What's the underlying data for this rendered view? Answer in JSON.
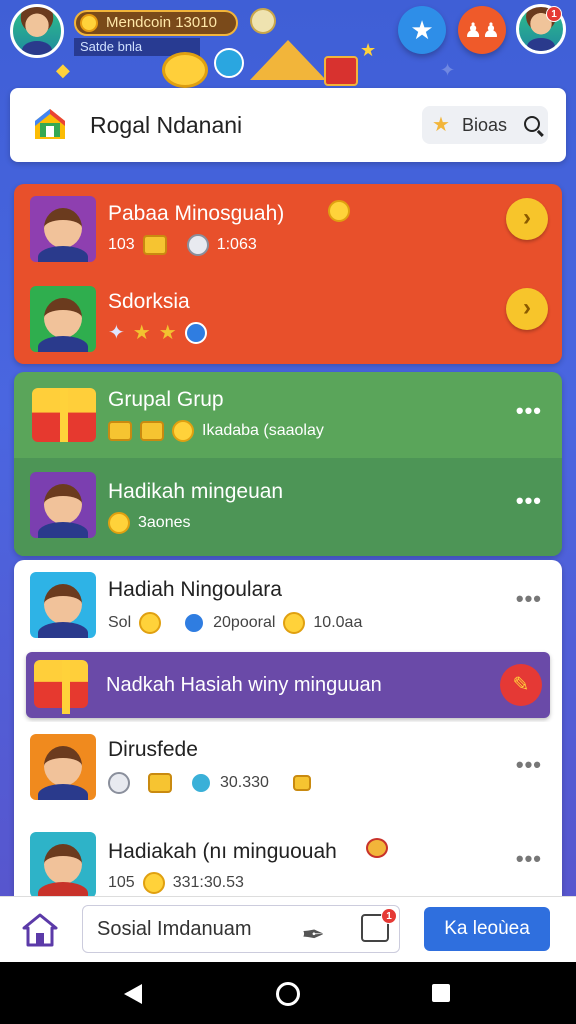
{
  "topbar": {
    "coins_text": "Mendcoin 13010",
    "sub_text": "Satde bnla"
  },
  "header": {
    "title": "Rogal Ndanani",
    "search_label": "Bioas"
  },
  "orange_card": {
    "rows": [
      {
        "title": "Pabaa Minosguah)",
        "meta_left": "103",
        "meta_right": "1:063"
      },
      {
        "title": "Sdorksia"
      }
    ]
  },
  "green_card": {
    "rows": [
      {
        "title": "Grupal Grup",
        "meta": "Ikadaba (saaolay"
      },
      {
        "title": "Hadikah mingeuan",
        "meta": "3aones"
      }
    ]
  },
  "white_card": {
    "rows": [
      {
        "title": "Hadiah Ningoulara",
        "meta_a": "Sol",
        "meta_b": "20pooral",
        "meta_c": "10.0aa"
      },
      {
        "title": "Dirusfede",
        "meta": "30.330"
      },
      {
        "title": "Hadiakah (nı minguouah",
        "meta_a": "105",
        "meta_b": "331:30.53"
      }
    ]
  },
  "banner": {
    "text": "Nadkah Hasiah winy minguuan"
  },
  "bottombar": {
    "field_text": "Sosial Imdanuam",
    "chat_badge": "1",
    "button_label": "Ka leoùea"
  },
  "notifications": {
    "avatar_badge": "1"
  },
  "colors": {
    "orange": "#e8502b",
    "green": "#5aa55a",
    "green_dark": "#4d9556",
    "purple": "#6a4aa8",
    "primary": "#2f6fde"
  }
}
